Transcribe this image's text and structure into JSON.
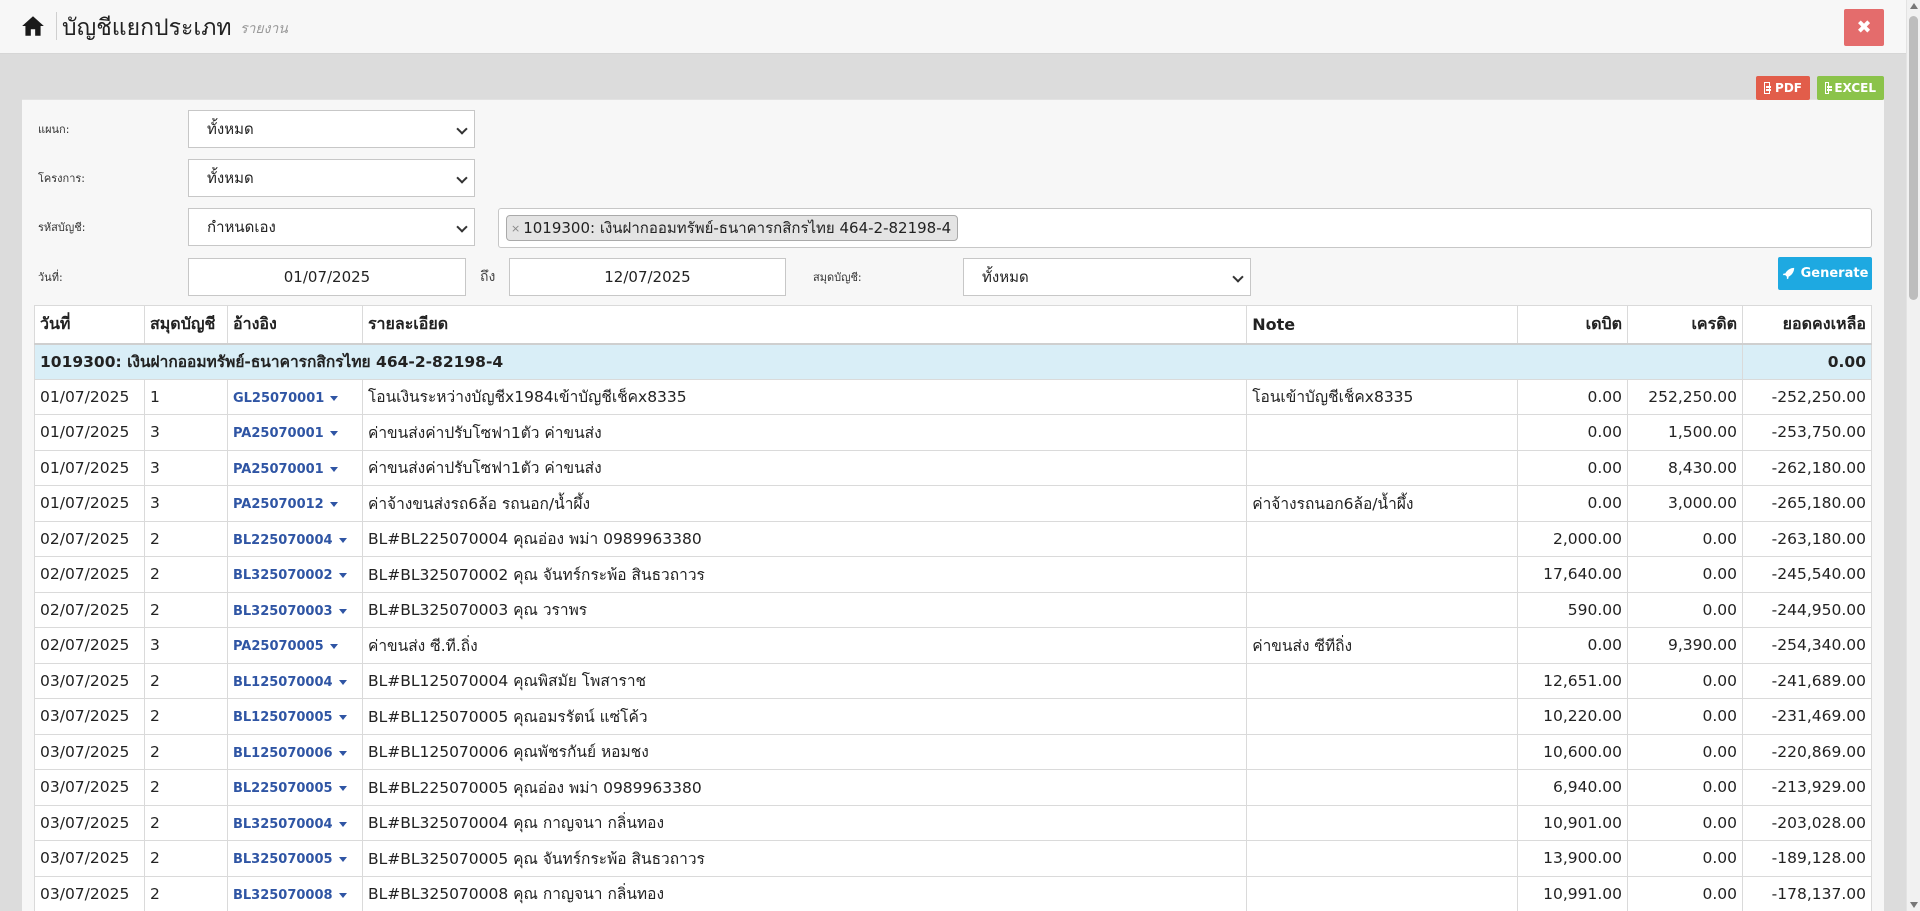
{
  "header": {
    "title": "บัญชีแยกประเภท",
    "subtitle": "รายงาน"
  },
  "export": {
    "pdf_label": "PDF",
    "excel_label": "EXCEL"
  },
  "filters": {
    "department_label": "แผนก:",
    "department_value": "ทั้งหมด",
    "project_label": "โครงการ:",
    "project_value": "ทั้งหมด",
    "account_label": "รหัสบัญชี:",
    "account_value": "กำหนดเอง",
    "account_chip": "1019300: เงินฝากออมทรัพย์-ธนาคารกสิกรไทย 464-2-82198-4",
    "date_label": "วันที่:",
    "date_from": "01/07/2025",
    "to_label": "ถึง",
    "date_to": "12/07/2025",
    "journal_label": "สมุดบัญชี:",
    "journal_value": "ทั้งหมด",
    "generate_label": "Generate"
  },
  "table": {
    "headers": {
      "date": "วันที่",
      "journal": "สมุดบัญชี",
      "ref": "อ้างอิง",
      "detail": "รายละเอียด",
      "note": "Note",
      "debit": "เดบิต",
      "credit": "เครดิต",
      "balance": "ยอดคงเหลือ"
    },
    "group": {
      "label": "1019300: เงินฝากออมทรัพย์-ธนาคารกสิกรไทย 464-2-82198-4",
      "balance": "0.00"
    },
    "rows": [
      {
        "date": "01/07/2025",
        "journal": "1",
        "ref": "GL25070001",
        "detail": "โอนเงินระหว่างบัญชีx1984เข้าบัญชีเช็คx8335",
        "note": "โอนเข้าบัญชีเช็คx8335",
        "debit": "0.00",
        "credit": "252,250.00",
        "balance": "-252,250.00"
      },
      {
        "date": "01/07/2025",
        "journal": "3",
        "ref": "PA25070001",
        "detail": "ค่าขนส่งค่าปรับโซฟา1ตัว ค่าขนส่ง",
        "note": "",
        "debit": "0.00",
        "credit": "1,500.00",
        "balance": "-253,750.00"
      },
      {
        "date": "01/07/2025",
        "journal": "3",
        "ref": "PA25070001",
        "detail": "ค่าขนส่งค่าปรับโซฟา1ตัว ค่าขนส่ง",
        "note": "",
        "debit": "0.00",
        "credit": "8,430.00",
        "balance": "-262,180.00"
      },
      {
        "date": "01/07/2025",
        "journal": "3",
        "ref": "PA25070012",
        "detail": "ค่าจ้างขนส่งรถ6ล้อ รถนอก/น้ำผึ้ง",
        "note": "ค่าจ้างรถนอก6ล้อ/น้ำผึ้ง",
        "debit": "0.00",
        "credit": "3,000.00",
        "balance": "-265,180.00"
      },
      {
        "date": "02/07/2025",
        "journal": "2",
        "ref": "BL225070004",
        "detail": "BL#BL225070004 คุณอ่อง พม่า 0989963380",
        "note": "",
        "debit": "2,000.00",
        "credit": "0.00",
        "balance": "-263,180.00"
      },
      {
        "date": "02/07/2025",
        "journal": "2",
        "ref": "BL325070002",
        "detail": "BL#BL325070002 คุณ จันทร์กระพ้อ สินธวถาวร",
        "note": "",
        "debit": "17,640.00",
        "credit": "0.00",
        "balance": "-245,540.00"
      },
      {
        "date": "02/07/2025",
        "journal": "2",
        "ref": "BL325070003",
        "detail": "BL#BL325070003 คุณ วราพร",
        "note": "",
        "debit": "590.00",
        "credit": "0.00",
        "balance": "-244,950.00"
      },
      {
        "date": "02/07/2025",
        "journal": "3",
        "ref": "PA25070005",
        "detail": "ค่าขนส่ง ซี.ที.ถิ่ง",
        "note": "ค่าขนส่ง ซีทีถิ่ง",
        "debit": "0.00",
        "credit": "9,390.00",
        "balance": "-254,340.00"
      },
      {
        "date": "03/07/2025",
        "journal": "2",
        "ref": "BL125070004",
        "detail": "BL#BL125070004 คุณพิสมัย โพสาราช",
        "note": "",
        "debit": "12,651.00",
        "credit": "0.00",
        "balance": "-241,689.00"
      },
      {
        "date": "03/07/2025",
        "journal": "2",
        "ref": "BL125070005",
        "detail": "BL#BL125070005 คุณอมรรัตน์ แซ่โค้ว",
        "note": "",
        "debit": "10,220.00",
        "credit": "0.00",
        "balance": "-231,469.00"
      },
      {
        "date": "03/07/2025",
        "journal": "2",
        "ref": "BL125070006",
        "detail": "BL#BL125070006 คุณพัชรกันย์ หอมชง",
        "note": "",
        "debit": "10,600.00",
        "credit": "0.00",
        "balance": "-220,869.00"
      },
      {
        "date": "03/07/2025",
        "journal": "2",
        "ref": "BL225070005",
        "detail": "BL#BL225070005 คุณอ่อง พม่า 0989963380",
        "note": "",
        "debit": "6,940.00",
        "credit": "0.00",
        "balance": "-213,929.00"
      },
      {
        "date": "03/07/2025",
        "journal": "2",
        "ref": "BL325070004",
        "detail": "BL#BL325070004 คุณ กาญจนา กลิ่นทอง",
        "note": "",
        "debit": "10,901.00",
        "credit": "0.00",
        "balance": "-203,028.00"
      },
      {
        "date": "03/07/2025",
        "journal": "2",
        "ref": "BL325070005",
        "detail": "BL#BL325070005 คุณ จันทร์กระพ้อ สินธวถาวร",
        "note": "",
        "debit": "13,900.00",
        "credit": "0.00",
        "balance": "-189,128.00"
      },
      {
        "date": "03/07/2025",
        "journal": "2",
        "ref": "BL325070008",
        "detail": "BL#BL325070008 คุณ กาญจนา กลิ่นทอง",
        "note": "",
        "debit": "10,991.00",
        "credit": "0.00",
        "balance": "-178,137.00"
      }
    ]
  }
}
